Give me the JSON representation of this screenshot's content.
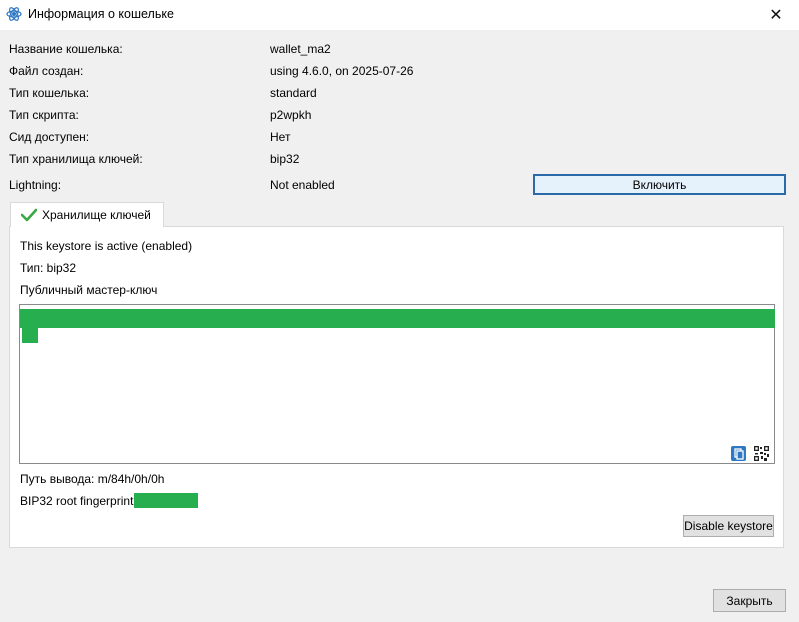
{
  "window": {
    "title": "Информация о кошельке",
    "close_glyph": "✕",
    "icon": "electrum-logo-icon"
  },
  "info_rows": [
    {
      "label": "Название кошелька:",
      "value": "wallet_ma2"
    },
    {
      "label": "Файл создан:",
      "value": "using 4.6.0, on 2025-07-26"
    },
    {
      "label": "Тип кошелька:",
      "value": "standard"
    },
    {
      "label": "Тип скрипта:",
      "value": "p2wpkh"
    },
    {
      "label": "Сид доступен:",
      "value": "Нет"
    },
    {
      "label": "Тип хранилища ключей:",
      "value": "bip32"
    }
  ],
  "lightning": {
    "label": "Lightning:",
    "value": "Not enabled",
    "enable_button": "Включить"
  },
  "keystore_tab": {
    "label": "Хранилище ключей",
    "icon": "checkmark-icon",
    "status": "This keystore is active (enabled)",
    "type_line": "Тип: bip32",
    "master_key_label": "Публичный мастер-ключ",
    "derivation_line": "Путь вывода:  m/84h/0h/0h",
    "fingerprint_label": "BIP32 root fingerprint",
    "disable_button": "Disable keystore"
  },
  "footer": {
    "close_button": "Закрыть"
  },
  "colors": {
    "accent_border": "#2b6aa8",
    "redaction": "#27ae4f",
    "copy_icon": "#2f78c4"
  }
}
